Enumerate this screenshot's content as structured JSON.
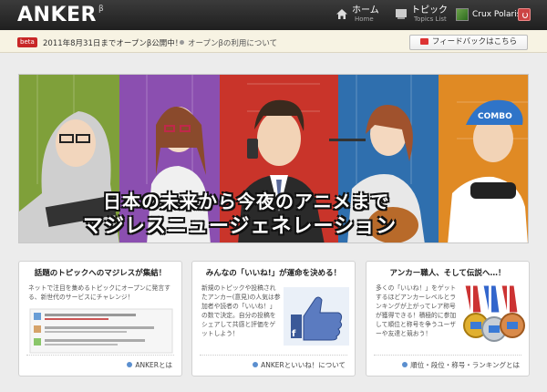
{
  "header": {
    "logo": "ANKER",
    "logo_sup": "β",
    "nav": [
      {
        "label": "ホーム",
        "sub": "Home"
      },
      {
        "label": "トピック",
        "sub": "Topics List"
      }
    ],
    "user_name": "Crux Polaris"
  },
  "notice": {
    "badge": "beta",
    "text": "2011年8月31日までオープンβ公開中！",
    "link": "オープンβの利用について",
    "feedback": "フィードバックはこちら"
  },
  "hero": {
    "line1": "日本の未来から今夜のアニメまで",
    "line2": "マジレスニュージェネレーション",
    "cap_text": "COMBO"
  },
  "cards": [
    {
      "title": "話題のトピックへのマジレスが集結！",
      "desc": "ネットで注目を集めるトピックにオープンに発言する、新世代のサービスにチャレンジ！",
      "link": "ANKERとは"
    },
    {
      "title": "みんなの「いいね!」が運命を決める！",
      "desc": "新規のトピックや投稿されたアンカー(意見)の人気は参加者や読者の「いいね！」の数で決定。自分の投稿をシェアして共感と評価をゲットしよう！",
      "link": "ANKERといいね！について"
    },
    {
      "title": "アンカー職人、そして伝説へ…！",
      "desc": "多くの「いいね！」をゲットするほどアンカーレベルとランキングが上がってレア称号が獲得できる！積極的に参加して順位と称号を争うユーザーや友達と競おう！",
      "link": "順位・段位・称号・ランキングとは"
    }
  ],
  "colors": {
    "header_bg": "#2b2b2b",
    "beta_badge": "#c82727",
    "link_dot": "#5b8fcf",
    "like_blue": "#3b5998"
  }
}
